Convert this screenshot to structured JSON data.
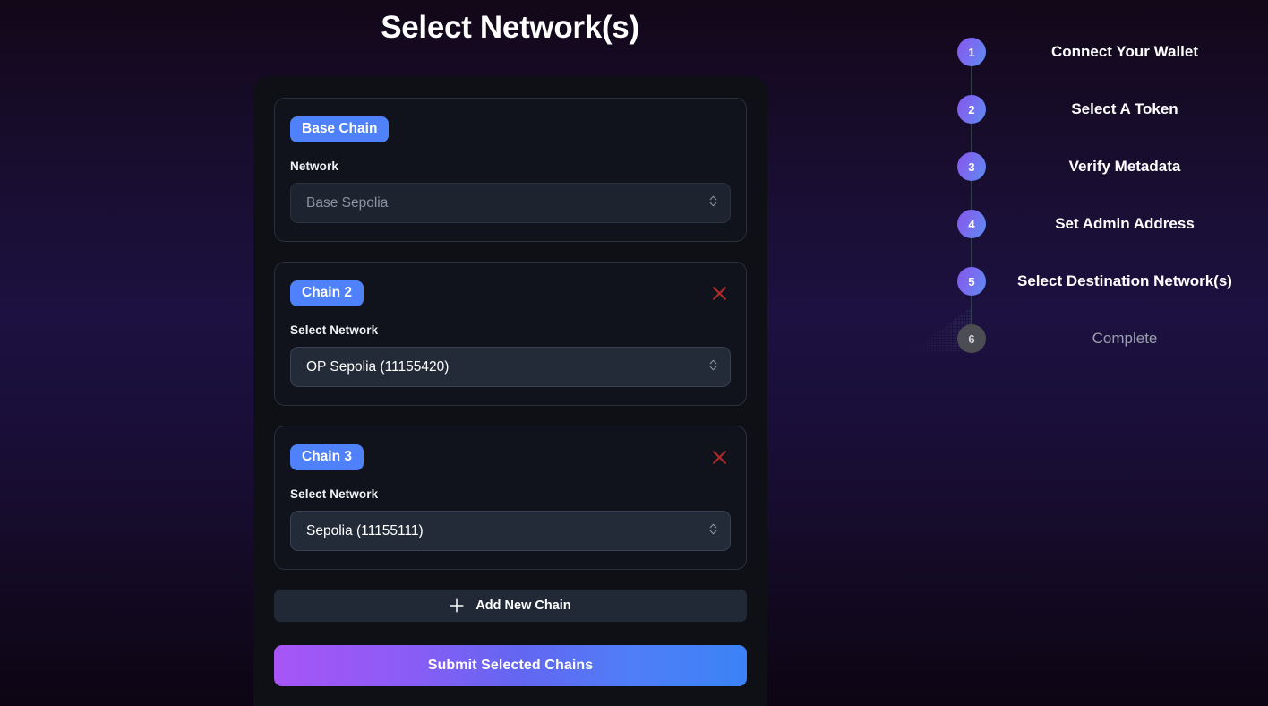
{
  "page": {
    "title": "Select Network(s)"
  },
  "colors": {
    "accent_blue": "#4f82fa",
    "badge_blue": "#4f82fa",
    "remove_red": "#b02a2a",
    "submit_gradient_from": "#a855f7",
    "submit_gradient_to": "#3b82f6",
    "step_active_from": "#8257ea",
    "step_active_to": "#5b8def",
    "step_inactive": "#4b4d52",
    "panel_bg": "#0e1016",
    "card_bg": "#10131b",
    "select_bg": "#242b38",
    "select_disabled_bg": "#1e242f"
  },
  "chains": [
    {
      "badge": "Base Chain",
      "field_label": "Network",
      "value": "Base Sepolia",
      "disabled": true,
      "removable": false,
      "remove_icon": "close-x-icon",
      "chevron_icon": "chevron-up-down-icon"
    },
    {
      "badge": "Chain 2",
      "field_label": "Select Network",
      "value": "OP Sepolia (11155420)",
      "disabled": false,
      "removable": true,
      "remove_icon": "close-x-icon",
      "chevron_icon": "chevron-up-down-icon"
    },
    {
      "badge": "Chain 3",
      "field_label": "Select Network",
      "value": "Sepolia (11155111)",
      "disabled": false,
      "removable": true,
      "remove_icon": "close-x-icon",
      "chevron_icon": "chevron-up-down-icon"
    }
  ],
  "actions": {
    "add_chain_label": "Add New Chain",
    "add_chain_icon": "plus-icon",
    "submit_label": "Submit Selected Chains"
  },
  "stepper": {
    "steps": [
      {
        "number": "1",
        "label": "Connect Your Wallet",
        "state": "active"
      },
      {
        "number": "2",
        "label": "Select A Token",
        "state": "active"
      },
      {
        "number": "3",
        "label": "Verify Metadata",
        "state": "active"
      },
      {
        "number": "4",
        "label": "Set Admin Address",
        "state": "active"
      },
      {
        "number": "5",
        "label": "Select Destination Network(s)",
        "state": "active"
      },
      {
        "number": "6",
        "label": "Complete",
        "state": "inactive"
      }
    ]
  }
}
